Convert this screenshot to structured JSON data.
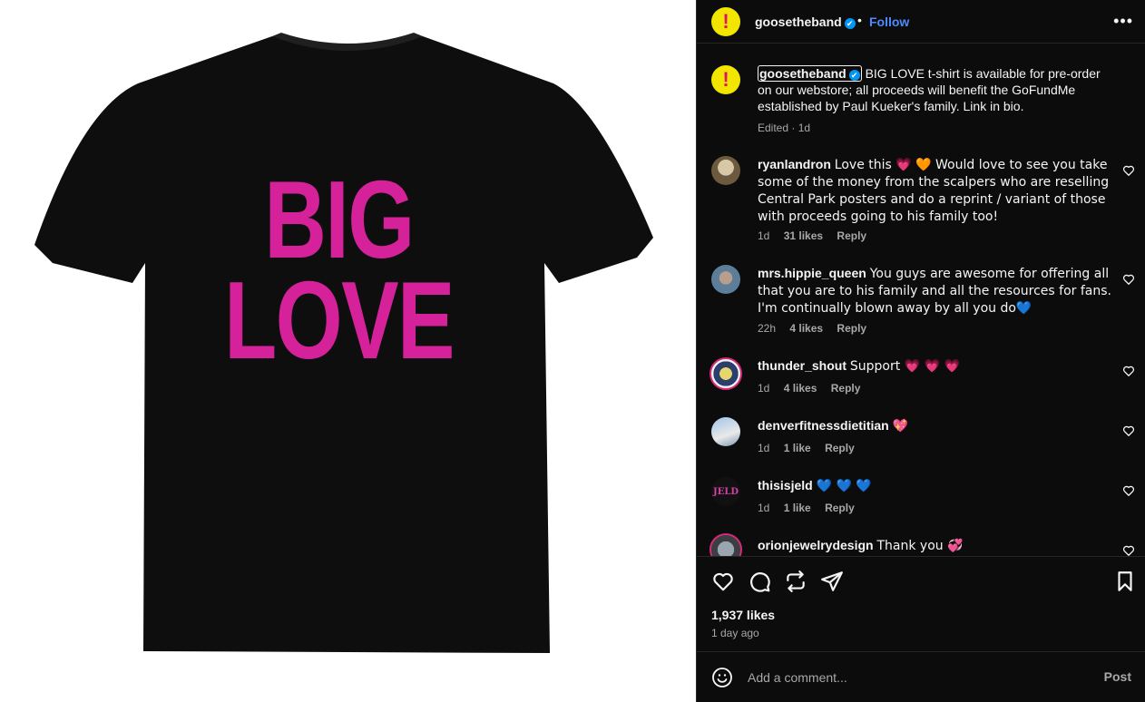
{
  "post_image": {
    "shirt_text_line1": "BIG",
    "shirt_text_line2": "LOVE",
    "shirt_color": "#0e0e0e",
    "print_color": "#d6229a"
  },
  "header": {
    "avatar_glyph": "!",
    "username": "goosetheband",
    "verified": "✔",
    "separator": "•",
    "follow_label": "Follow",
    "more_glyph": "•••"
  },
  "caption": {
    "username": "goosetheband",
    "text": "BIG LOVE t-shirt is available for pre-order on our webstore; all proceeds will benefit the GoFundMe established by Paul Kueker's family. Link in bio.",
    "meta": "Edited · 1d"
  },
  "comments": [
    {
      "username": "ryanlandron",
      "text": "Love this 💗 🧡  Would love to see you take some of the money from the scalpers who are reselling Central Park posters and do a reprint / variant of those with proceeds going to his family too!",
      "age": "1d",
      "likes": "31 likes",
      "reply": "Reply"
    },
    {
      "username": "mrs.hippie_queen",
      "text": "You guys are awesome for offering all that you are to his family and all the resources for fans. I'm continually blown away by all you do💙",
      "age": "22h",
      "likes": "4 likes",
      "reply": "Reply"
    },
    {
      "username": "thunder_shout",
      "text": "Support 💗 💗 💗",
      "age": "1d",
      "likes": "4 likes",
      "reply": "Reply"
    },
    {
      "username": "denverfitnessdietitian",
      "text": "💖",
      "age": "1d",
      "likes": "1 like",
      "reply": "Reply"
    },
    {
      "username": "thisisjeld",
      "avatar_text": "JELD",
      "text": "💙 💙 💙",
      "age": "1d",
      "likes": "1 like",
      "reply": "Reply"
    },
    {
      "username": "orionjewelrydesign",
      "text": "Thank you 💞",
      "age": "",
      "likes": "",
      "reply": ""
    }
  ],
  "actions": {
    "likes": "1,937 likes",
    "time_ago": "1 day ago",
    "icons": [
      "heart-icon",
      "comment-icon",
      "repost-icon",
      "share-icon",
      "bookmark-icon"
    ]
  },
  "add_comment": {
    "placeholder": "Add a comment...",
    "post_label": "Post"
  }
}
